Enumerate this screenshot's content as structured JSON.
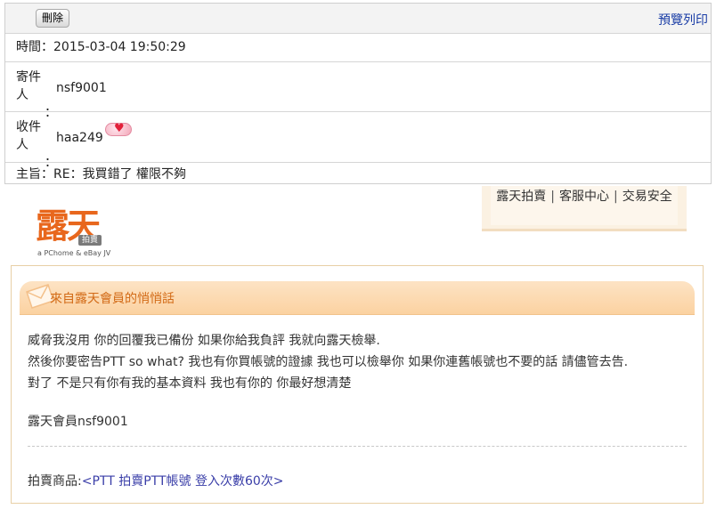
{
  "toolbar": {
    "delete_label": "刪除",
    "print_preview_label": "預覽列印"
  },
  "fields": {
    "time_label": "時間：",
    "time_value": "2015-03-04 19:50:29",
    "sender_label": "寄件人",
    "sender_colon": "：",
    "sender_value": "nsf9001",
    "receiver_label": "收件人",
    "receiver_colon": "：",
    "receiver_value": "haa249",
    "subject_label": "主旨：",
    "subject_value": "RE：我買錯了 權限不夠"
  },
  "logo": {
    "main": "露天",
    "sub": "拍賣",
    "tagline": "a PChome & eBay JV"
  },
  "topnav": {
    "items": [
      "露天拍賣",
      "客服中心",
      "交易安全"
    ],
    "separator": "|"
  },
  "panel": {
    "title": "來自露天會員的悄悄話",
    "message_lines": [
      "威脅我沒用 你的回覆我已備份 如果你給我負評 我就向露天檢舉.",
      "然後你要密告PTT so what? 我也有你買帳號的證據 我也可以檢舉你 如果你連舊帳號也不要的話 請儘管去告.",
      "對了 不是只有你有我的基本資料 我也有你的 你最好想清楚"
    ],
    "signature": "露天會員nsf9001",
    "product_label": "拍賣商品:",
    "product_link": "<PTT 拍賣PTT帳號 登入次數60次>"
  },
  "colors": {
    "accent_orange": "#d26a16",
    "link_blue": "#1a3da6",
    "panel_border": "#e8cfa6"
  },
  "icons": {
    "badge": "heart-badge-icon",
    "envelope": "envelope-icon"
  }
}
